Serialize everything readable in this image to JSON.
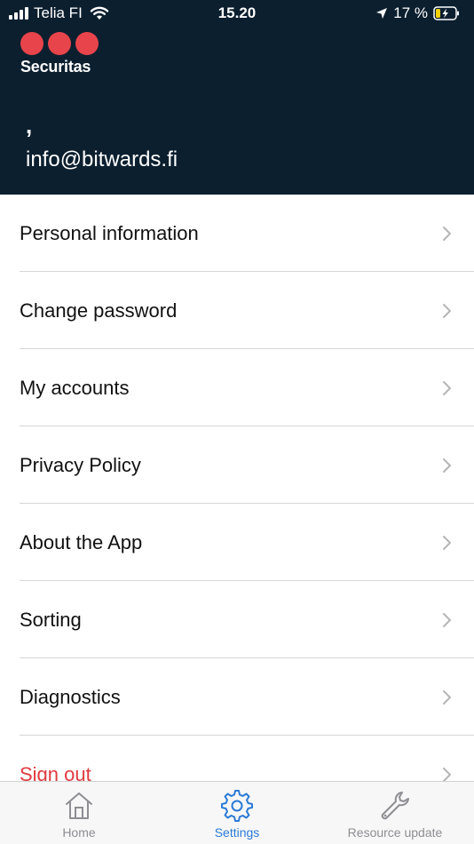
{
  "status_bar": {
    "carrier": "Telia FI",
    "time": "15.20",
    "battery": "17 %"
  },
  "header": {
    "brand": "Securitas",
    "user_name": ",",
    "email": "info@bitwards.fi"
  },
  "menu": [
    {
      "label": "Personal information"
    },
    {
      "label": "Change password"
    },
    {
      "label": "My accounts"
    },
    {
      "label": "Privacy Policy"
    },
    {
      "label": "About the App"
    },
    {
      "label": "Sorting"
    },
    {
      "label": "Diagnostics"
    },
    {
      "label": "Sign out"
    }
  ],
  "tabbar": {
    "home": "Home",
    "settings": "Settings",
    "resource_update": "Resource update"
  },
  "colors": {
    "header_bg": "#0c1f2f",
    "brand_red": "#e8444b",
    "danger": "#e03a3f",
    "active_tab": "#2b7bd6"
  }
}
